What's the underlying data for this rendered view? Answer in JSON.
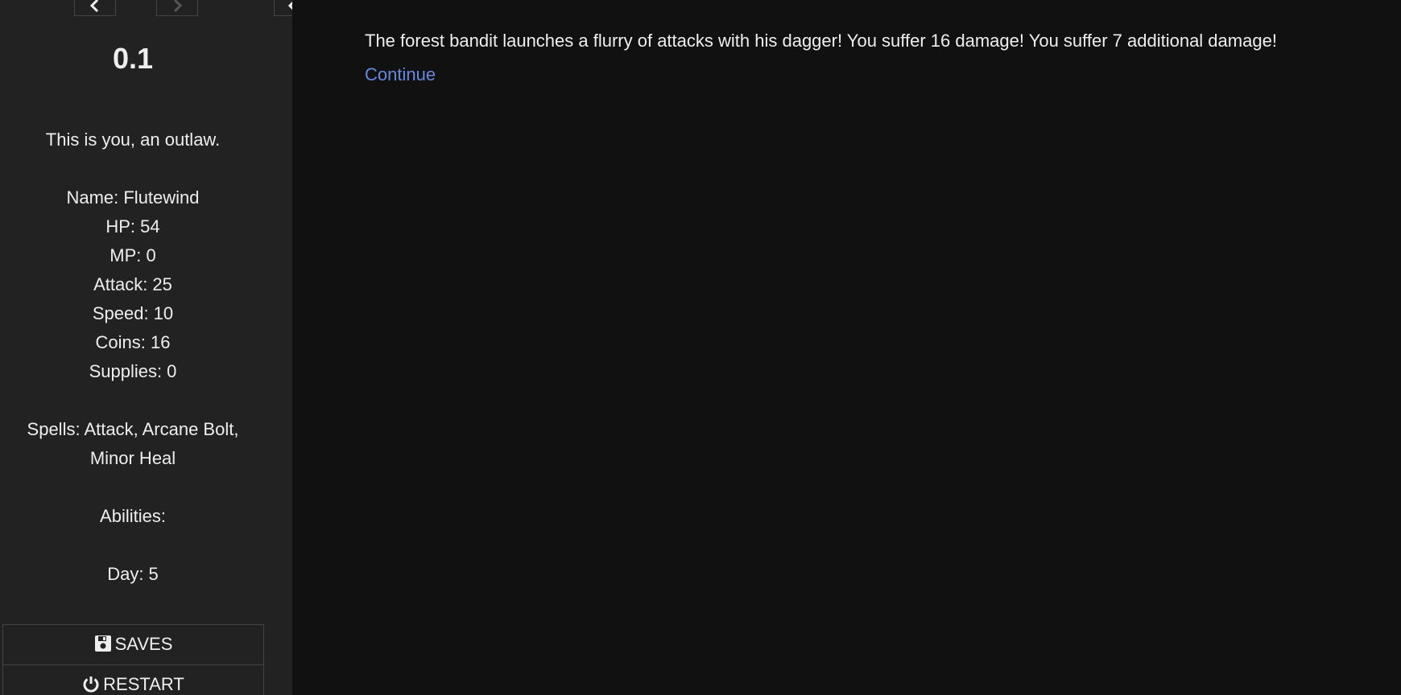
{
  "sidebar": {
    "history": {
      "back_icon": "chevron-left-icon",
      "forward_icon": "chevron-right-icon",
      "forward_disabled": true
    },
    "stow_icon": "chevron-left-icon",
    "version": "0.1",
    "caption": {
      "intro": "This is you, an outlaw.",
      "name": "Name: Flutewind",
      "hp": "HP: 54",
      "mp": "MP: 0",
      "attack": "Attack: 25",
      "speed": "Speed: 10",
      "coins": "Coins: 16",
      "supplies": "Supplies: 0",
      "spells_line1": "Spells: Attack, Arcane Bolt,",
      "spells_line2": "Minor Heal",
      "abilities": "Abilities:",
      "day": "Day: 5"
    },
    "menu": {
      "saves_label": "SAVES",
      "saves_icon": "floppy-disk-icon",
      "restart_label": "RESTART",
      "restart_icon": "power-icon"
    }
  },
  "passage": {
    "text": "The forest bandit launches a flurry of attacks with his dagger! You suffer 16 damage! You suffer 7 additional damage!",
    "continue_link": "Continue"
  },
  "colors": {
    "background": "#111111",
    "sidebar": "#222222",
    "text": "#eeeeee",
    "link": "#6688dd"
  }
}
